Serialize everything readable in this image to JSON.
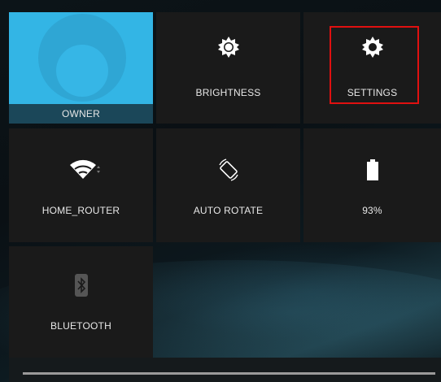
{
  "tiles": {
    "owner": {
      "label": "OWNER"
    },
    "brightness": {
      "label": "BRIGHTNESS"
    },
    "settings": {
      "label": "SETTINGS"
    },
    "wifi": {
      "label": "HOME_ROUTER"
    },
    "rotate": {
      "label": "AUTO ROTATE"
    },
    "battery": {
      "label": "93%",
      "level": 0.93
    },
    "bluetooth": {
      "label": "BLUETOOTH"
    }
  },
  "icons": {
    "brightness": "sun-gear-icon",
    "settings": "gear-icon",
    "wifi": "wifi-icon",
    "rotate": "auto-rotate-icon",
    "battery": "battery-icon",
    "bluetooth": "bluetooth-icon"
  },
  "colors": {
    "accent": "#33b5e5",
    "tile_bg": "#1a1a1a",
    "highlight": "#e01010"
  }
}
